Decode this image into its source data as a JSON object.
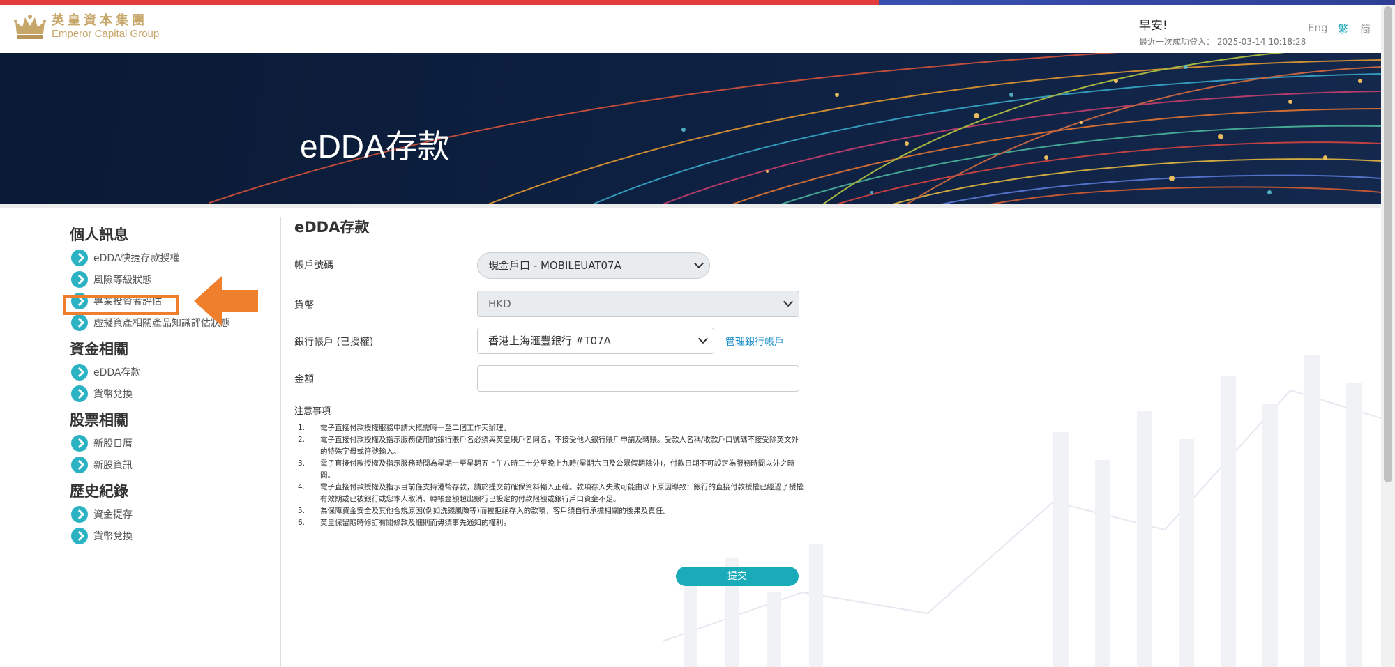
{
  "header": {
    "logo_cn": "英皇資本集團",
    "logo_en": "Emperor Capital Group",
    "greeting": "早安!",
    "last_login": "最近一次成功登入： 2025-03-14 10:18:28",
    "lang_en": "Eng",
    "lang_tc": "繁",
    "lang_sc": "简"
  },
  "banner": {
    "title": "eDDA存款"
  },
  "sidebar": {
    "sections": [
      {
        "title": "個人訊息",
        "items": [
          "eDDA快捷存款授權",
          "風險等級狀態",
          "專業投資者評估",
          "虛擬資產相關產品知識評估狀態"
        ]
      },
      {
        "title": "資金相關",
        "items": [
          "eDDA存款",
          "貨幣兌換"
        ]
      },
      {
        "title": "股票相關",
        "items": [
          "新股日曆",
          "新股資訊"
        ]
      },
      {
        "title": "歷史紀錄",
        "items": [
          "資金提存",
          "貨幣兌換"
        ]
      }
    ]
  },
  "form": {
    "title": "eDDA存款",
    "account_label": "帳戶號碼",
    "account_value": "現金戶口 - MOBILEUAT07A",
    "currency_label": "貨幣",
    "currency_value": "HKD",
    "bank_label": "銀行帳戶 (已授權)",
    "bank_value": "香港上海滙豐銀行 #T07A",
    "manage_link": "管理銀行帳戶",
    "amount_label": "金額",
    "amount_value": "",
    "notes_title": "注意事項",
    "notes": [
      "電子直接付款授權服務申請大概需時一至二個工作天辦理。",
      "電子直接付款授權及指示服務使用的銀行賬戶名必須與英皇賬戶名同名，不接受他人銀行賬戶申請及轉賬。受款人名稱/收款戶口號碼不接受除英文外的特殊字母或符號輸入。",
      "電子直接付款授權及指示服務時間為星期一至星期五上午八時三十分至晚上九時(星期六日及公眾假期除外)，付款日期不可設定為服務時間以外之時間。",
      "電子直接付款授權及指示目前僅支持港幣存款，請於提交前確保資料輸入正確。款項存入失敗可能由以下原因導致：銀行的直接付款授權已經過了授權有效期或已被銀行或您本人取消、轉帳金額超出銀行已設定的付款限額或銀行戶口資金不足。",
      "為保障資金安全及其他合規原因(例如洗錢風險等)而被拒絕存入的款項，客戶須自行承擔相關的後果及責任。",
      "英皇保留隨時修訂有關條款及細則而毋須事先通知的權利。"
    ],
    "note_numbers": [
      "1.",
      "2.",
      "3.",
      "4.",
      "5.",
      "6."
    ],
    "submit_label": "提交"
  }
}
